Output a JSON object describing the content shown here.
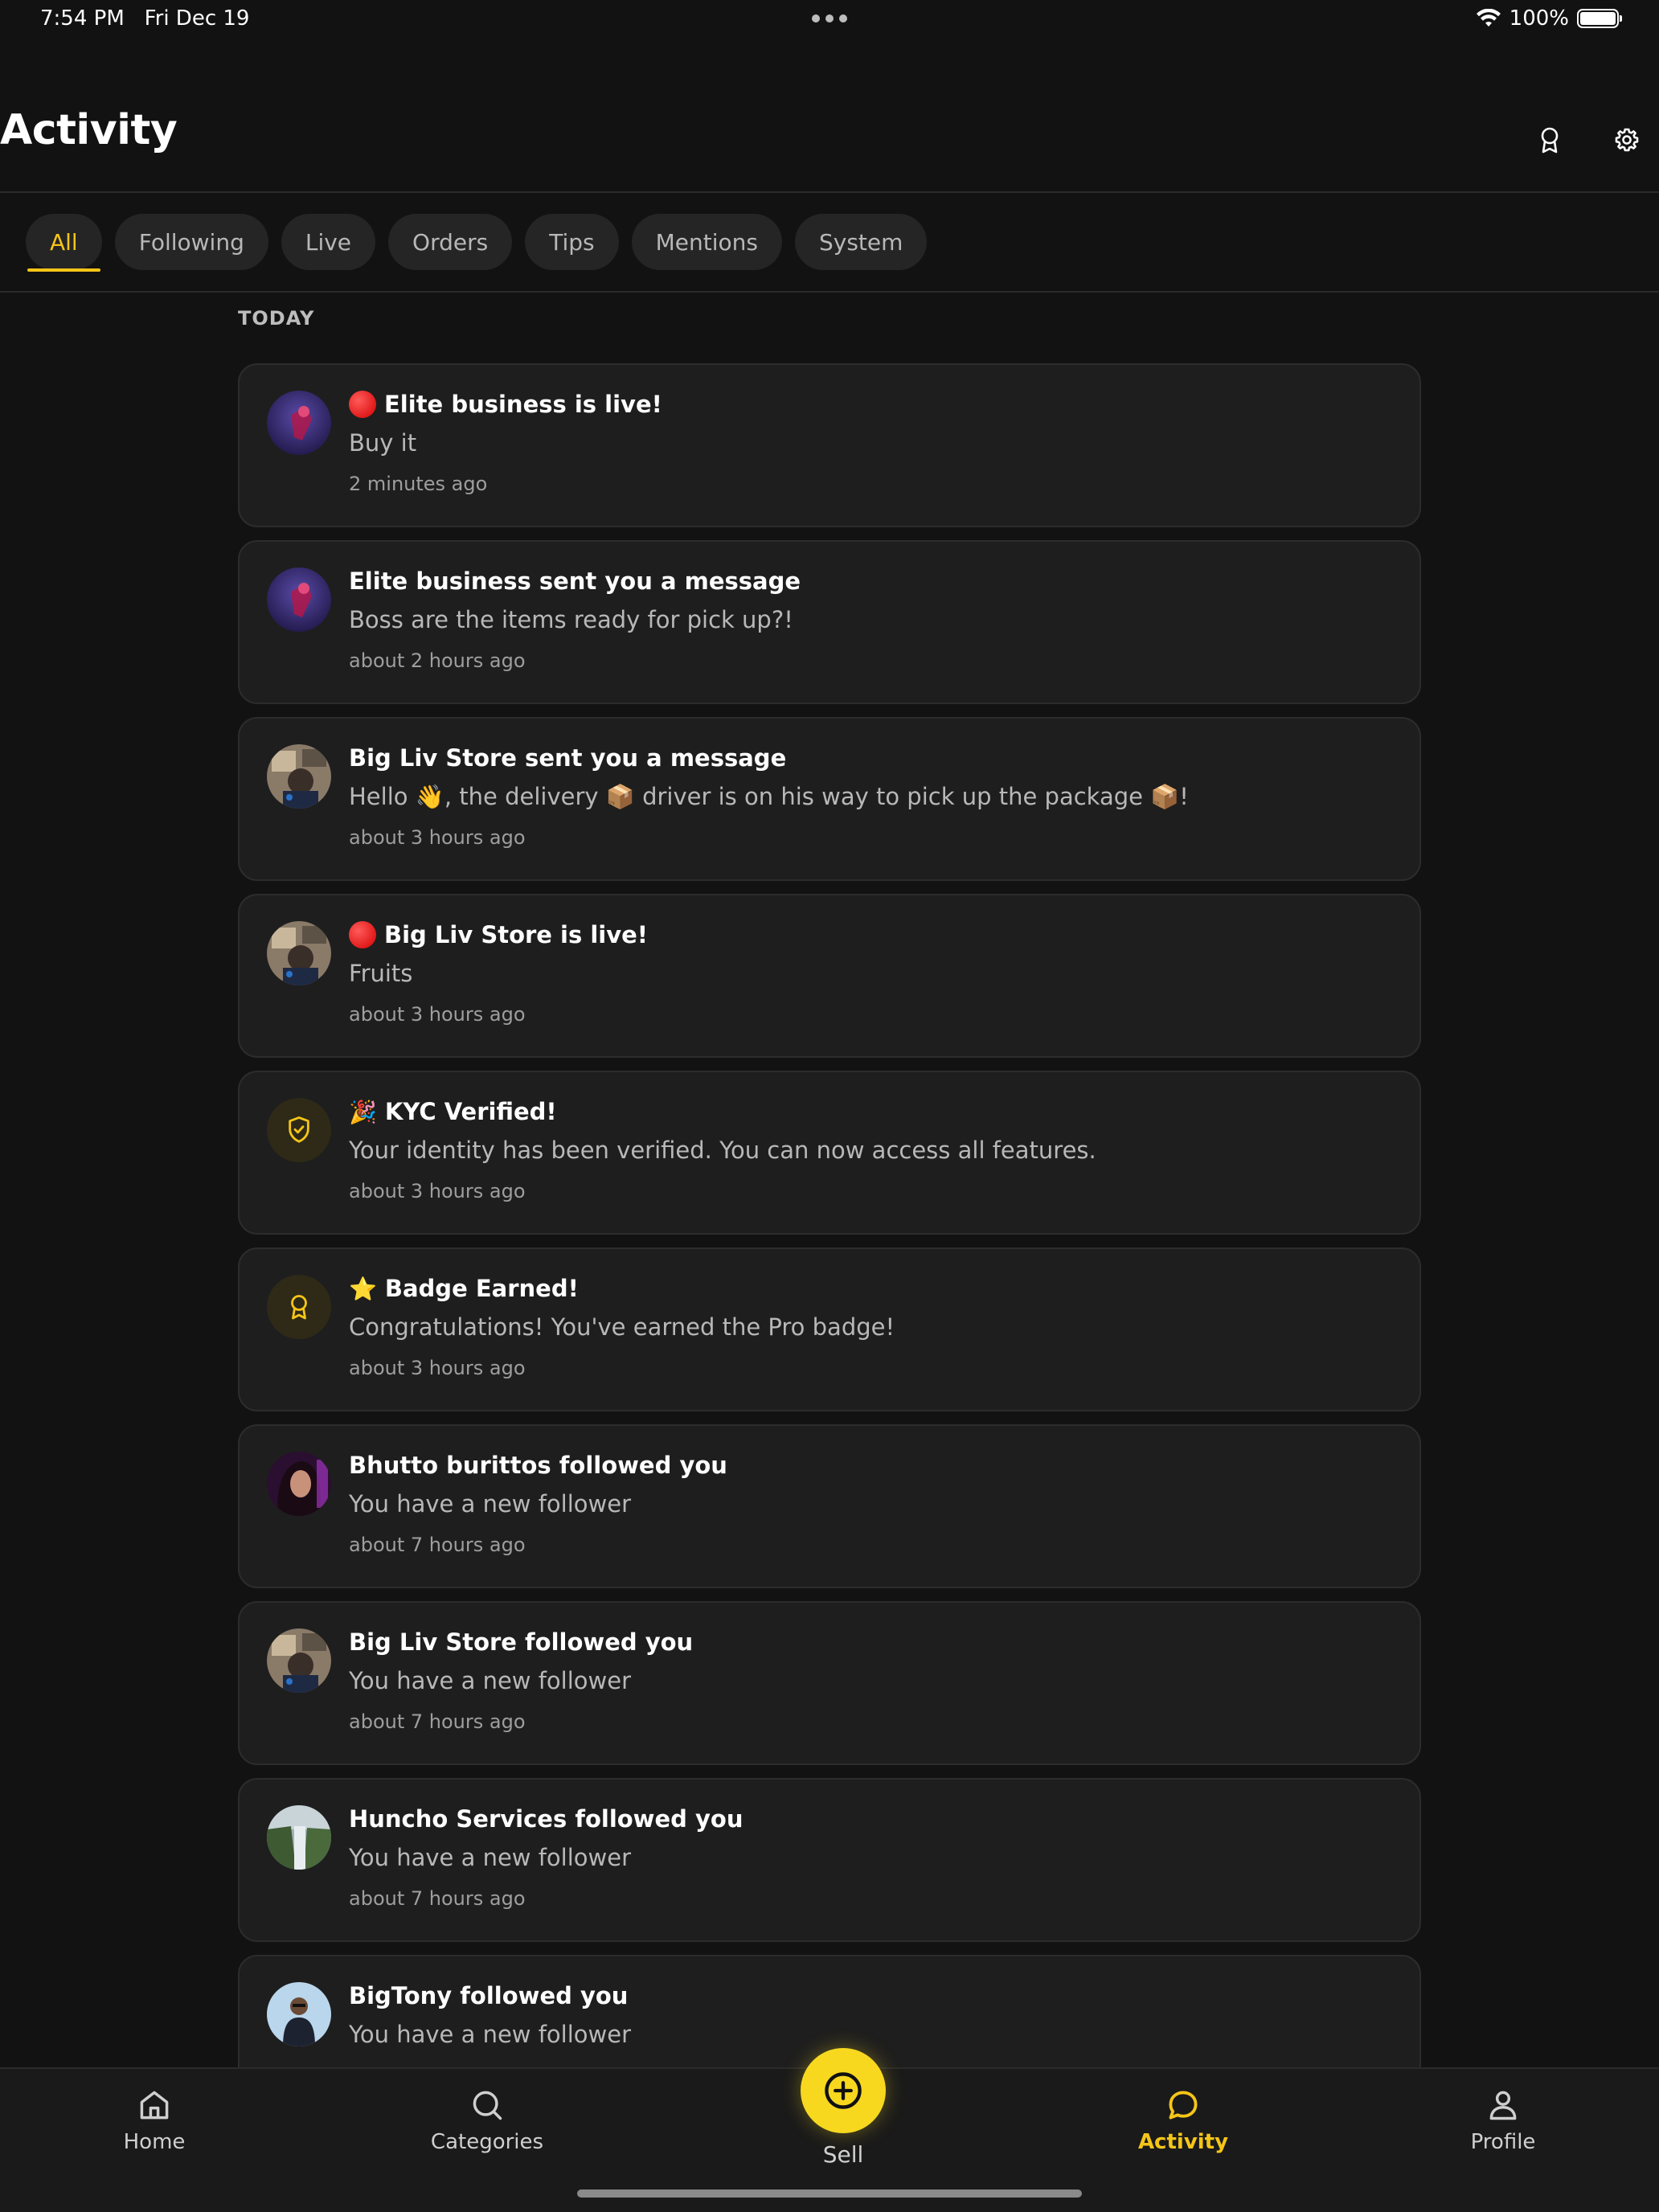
{
  "status_bar": {
    "time": "7:54 PM",
    "date": "Fri Dec 19",
    "battery_pct": "100%",
    "wifi_icon": "wifi-icon",
    "battery_icon": "battery-icon"
  },
  "header": {
    "title": "Activity",
    "icons": [
      "badge-icon",
      "gear-icon"
    ]
  },
  "tabs": [
    {
      "label": "All",
      "active": true
    },
    {
      "label": "Following",
      "active": false
    },
    {
      "label": "Live",
      "active": false
    },
    {
      "label": "Orders",
      "active": false
    },
    {
      "label": "Tips",
      "active": false
    },
    {
      "label": "Mentions",
      "active": false
    },
    {
      "label": "System",
      "active": false
    }
  ],
  "feed": {
    "section": "TODAY",
    "items": [
      {
        "prefix": "live",
        "title": "Elite business is live!",
        "body": "Buy it",
        "time": "2 minutes ago",
        "avatar": "elite-business-avatar"
      },
      {
        "prefix": "",
        "title": "Elite business sent you a message",
        "body": "Boss are the items ready for pick up?!",
        "time": "about 2 hours ago",
        "avatar": "elite-business-avatar"
      },
      {
        "prefix": "",
        "title": "Big Liv Store sent you a message",
        "body": "Hello 👋, the delivery 📦 driver is on his way to pick up the package 📦!",
        "time": "about 3 hours ago",
        "avatar": "big-liv-store-avatar"
      },
      {
        "prefix": "live",
        "title": "Big Liv Store is live!",
        "body": "Fruits",
        "time": "about 3 hours ago",
        "avatar": "big-liv-store-avatar"
      },
      {
        "prefix": "🎉",
        "title": "KYC Verified!",
        "body": "Your identity has been verified. You can now access all features.",
        "time": "about 3 hours ago",
        "avatar": "shield-check-icon"
      },
      {
        "prefix": "⭐",
        "title": "Badge Earned!",
        "body": "Congratulations! You've earned the Pro badge!",
        "time": "about 3 hours ago",
        "avatar": "award-icon"
      },
      {
        "prefix": "",
        "title": "Bhutto burittos followed you",
        "body": "You have a new follower",
        "time": "about 7 hours ago",
        "avatar": "bhutto-burittos-avatar"
      },
      {
        "prefix": "",
        "title": "Big Liv Store followed you",
        "body": "You have a new follower",
        "time": "about 7 hours ago",
        "avatar": "big-liv-store-avatar"
      },
      {
        "prefix": "",
        "title": "Huncho Services followed you",
        "body": "You have a new follower",
        "time": "about 7 hours ago",
        "avatar": "huncho-services-avatar"
      },
      {
        "prefix": "",
        "title": "BigTony followed you",
        "body": "You have a new follower",
        "time": "",
        "avatar": "bigtony-avatar"
      }
    ]
  },
  "bottom_nav": {
    "home": {
      "label": "Home",
      "icon": "home-icon"
    },
    "categories": {
      "label": "Categories",
      "icon": "search-icon"
    },
    "sell": {
      "label": "Sell",
      "icon": "plus-circle-icon"
    },
    "activity": {
      "label": "Activity",
      "icon": "chat-bubble-icon",
      "active": true
    },
    "profile": {
      "label": "Profile",
      "icon": "user-icon"
    }
  },
  "colors": {
    "accent": "#f5c518",
    "background": "#121212",
    "card": "#1e1e1e"
  }
}
